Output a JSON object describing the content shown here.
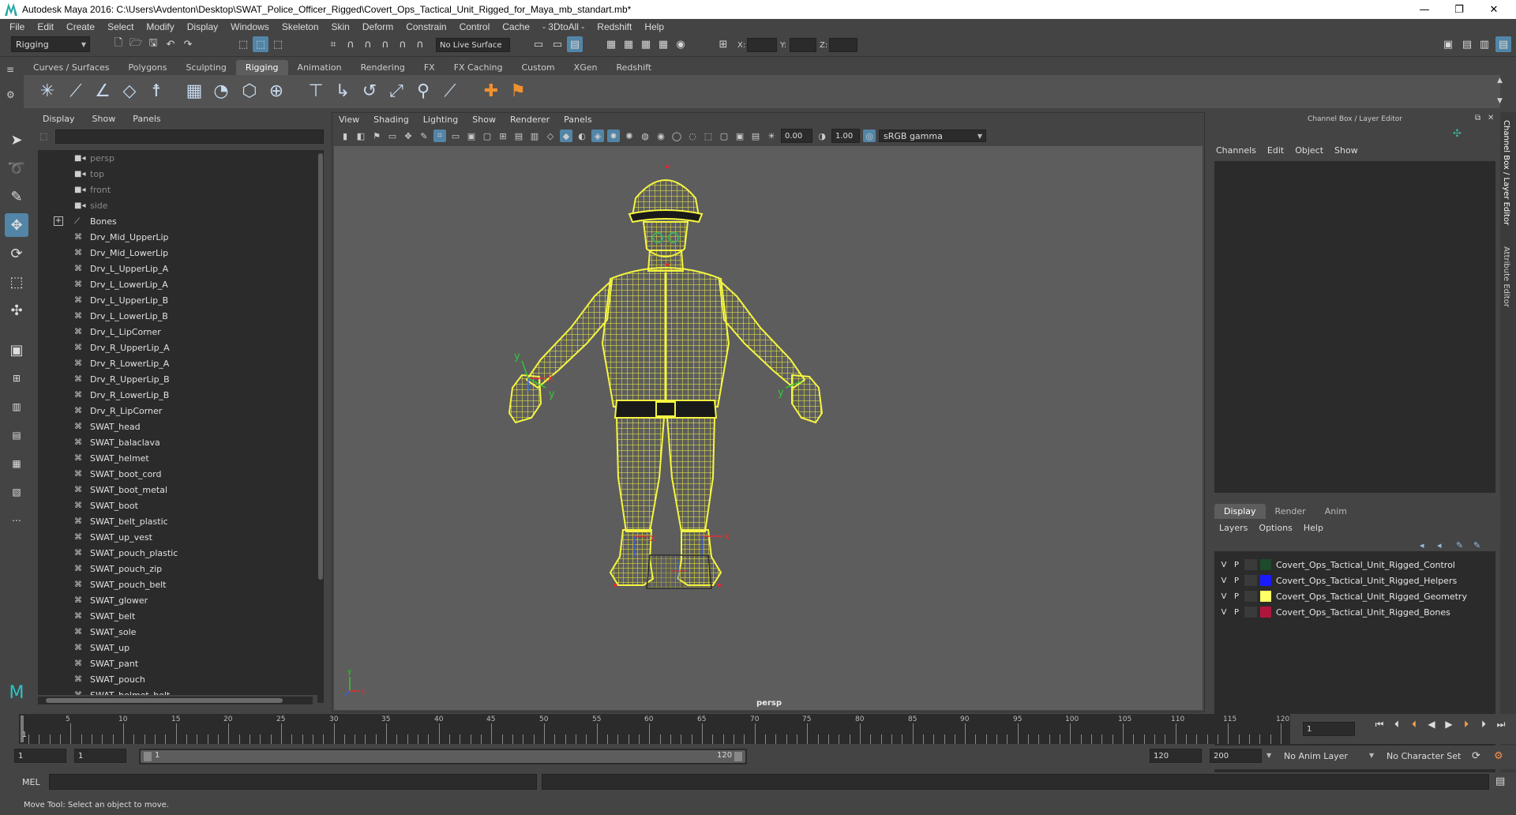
{
  "window": {
    "title": "Autodesk Maya 2016: C:\\Users\\Avdenton\\Desktop\\SWAT_Police_Officer_Rigged\\Covert_Ops_Tactical_Unit_Rigged_for_Maya_mb_standart.mb*",
    "minimize": "—",
    "maximize": "❐",
    "close": "✕"
  },
  "menubar": [
    "File",
    "Edit",
    "Create",
    "Select",
    "Modify",
    "Display",
    "Windows",
    "Skeleton",
    "Skin",
    "Deform",
    "Constrain",
    "Control",
    "Cache",
    "- 3DtoAll -",
    "Redshift",
    "Help"
  ],
  "statusline": {
    "menuset": "Rigging",
    "live_surface": "No Live Surface",
    "x_label": "X:",
    "y_label": "Y:",
    "z_label": "Z:"
  },
  "shelf": {
    "tabs": [
      "Curves / Surfaces",
      "Polygons",
      "Sculpting",
      "Rigging",
      "Animation",
      "Rendering",
      "FX",
      "FX Caching",
      "Custom",
      "XGen",
      "Redshift"
    ],
    "active": "Rigging"
  },
  "outliner": {
    "menu": [
      "Display",
      "Show",
      "Panels"
    ],
    "items": [
      {
        "label": "persp",
        "icon": "camera-icon",
        "dim": true
      },
      {
        "label": "top",
        "icon": "camera-icon",
        "dim": true
      },
      {
        "label": "front",
        "icon": "camera-icon",
        "dim": true
      },
      {
        "label": "side",
        "icon": "camera-icon",
        "dim": true
      },
      {
        "label": "Bones",
        "icon": "joint-icon",
        "expand": true
      },
      {
        "label": "Drv_Mid_UpperLip",
        "icon": "mesh-icon"
      },
      {
        "label": "Drv_Mid_LowerLip",
        "icon": "mesh-icon"
      },
      {
        "label": "Drv_L_UpperLip_A",
        "icon": "mesh-icon"
      },
      {
        "label": "Drv_L_LowerLip_A",
        "icon": "mesh-icon"
      },
      {
        "label": "Drv_L_UpperLip_B",
        "icon": "mesh-icon"
      },
      {
        "label": "Drv_L_LowerLip_B",
        "icon": "mesh-icon"
      },
      {
        "label": "Drv_L_LipCorner",
        "icon": "mesh-icon"
      },
      {
        "label": "Drv_R_UpperLip_A",
        "icon": "mesh-icon"
      },
      {
        "label": "Drv_R_LowerLip_A",
        "icon": "mesh-icon"
      },
      {
        "label": "Drv_R_UpperLip_B",
        "icon": "mesh-icon"
      },
      {
        "label": "Drv_R_LowerLip_B",
        "icon": "mesh-icon"
      },
      {
        "label": "Drv_R_LipCorner",
        "icon": "mesh-icon"
      },
      {
        "label": "SWAT_head",
        "icon": "mesh-icon"
      },
      {
        "label": "SWAT_balaclava",
        "icon": "mesh-icon"
      },
      {
        "label": "SWAT_helmet",
        "icon": "mesh-icon"
      },
      {
        "label": "SWAT_boot_cord",
        "icon": "mesh-icon"
      },
      {
        "label": "SWAT_boot_metal",
        "icon": "mesh-icon"
      },
      {
        "label": "SWAT_boot",
        "icon": "mesh-icon"
      },
      {
        "label": "SWAT_belt_plastic",
        "icon": "mesh-icon"
      },
      {
        "label": "SWAT_up_vest",
        "icon": "mesh-icon"
      },
      {
        "label": "SWAT_pouch_plastic",
        "icon": "mesh-icon"
      },
      {
        "label": "SWAT_pouch_zip",
        "icon": "mesh-icon"
      },
      {
        "label": "SWAT_pouch_belt",
        "icon": "mesh-icon"
      },
      {
        "label": "SWAT_glower",
        "icon": "mesh-icon"
      },
      {
        "label": "SWAT_belt",
        "icon": "mesh-icon"
      },
      {
        "label": "SWAT_sole",
        "icon": "mesh-icon"
      },
      {
        "label": "SWAT_up",
        "icon": "mesh-icon"
      },
      {
        "label": "SWAT_pant",
        "icon": "mesh-icon"
      },
      {
        "label": "SWAT_pouch",
        "icon": "mesh-icon"
      },
      {
        "label": "SWAT_helmet_belt",
        "icon": "mesh-icon"
      }
    ]
  },
  "viewport": {
    "menu": [
      "View",
      "Shading",
      "Lighting",
      "Show",
      "Renderer",
      "Panels"
    ],
    "exposure": "0.00",
    "gamma": "1.00",
    "color_space": "sRGB gamma",
    "camera_label": "persp",
    "axis_labels": {
      "x": "x",
      "y": "y",
      "z": "z"
    },
    "wire_color": "#f5f542"
  },
  "channel_box": {
    "title": "Channel Box / Layer Editor",
    "menu": [
      "Channels",
      "Edit",
      "Object",
      "Show"
    ]
  },
  "layer_editor": {
    "tabs": [
      "Display",
      "Render",
      "Anim"
    ],
    "active": "Display",
    "menu": [
      "Layers",
      "Options",
      "Help"
    ],
    "layers": [
      {
        "v": "V",
        "p": "P",
        "name": "Covert_Ops_Tactical_Unit_Rigged_Control",
        "color": "#1c4a2a"
      },
      {
        "v": "V",
        "p": "P",
        "name": "Covert_Ops_Tactical_Unit_Rigged_Helpers",
        "color": "#1a1aff"
      },
      {
        "v": "V",
        "p": "P",
        "name": "Covert_Ops_Tactical_Unit_Rigged_Geometry",
        "color": "#ffff66"
      },
      {
        "v": "V",
        "p": "P",
        "name": "Covert_Ops_Tactical_Unit_Rigged_Bones",
        "color": "#b0163c"
      }
    ]
  },
  "side_tabs": [
    "Channel Box / Layer Editor",
    "Attribute Editor"
  ],
  "time_slider": {
    "labels": [
      "5",
      "10",
      "15",
      "20",
      "25",
      "30",
      "35",
      "40",
      "45",
      "50",
      "55",
      "60",
      "65",
      "70",
      "75",
      "80",
      "85",
      "90",
      "95",
      "100",
      "105",
      "110",
      "115",
      "120"
    ],
    "current_frame_marker": "1",
    "current_frame": "1"
  },
  "range_slider": {
    "start": "1",
    "anim_start": "1",
    "range_start_label": "1",
    "range_end_label": "120",
    "anim_end": "120",
    "end": "200",
    "anim_layer": "No Anim Layer",
    "character_set": "No Character Set"
  },
  "command_line": {
    "label": "MEL"
  },
  "help_line": {
    "text": "Move Tool: Select an object to move."
  }
}
